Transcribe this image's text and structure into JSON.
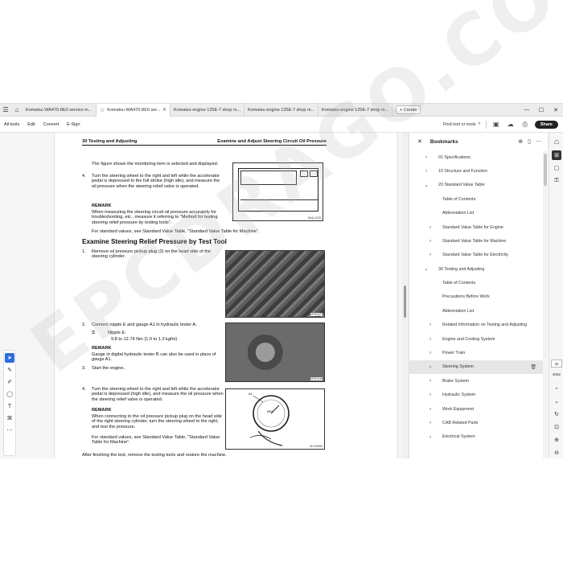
{
  "tabs": [
    {
      "label": "Komatsu WA470-8E0 service m...",
      "active": false,
      "starred": false
    },
    {
      "label": "Komatsu WA470-8E0 ser...",
      "active": true,
      "starred": true
    },
    {
      "label": "Komatsu engine 125E-7 shop m...",
      "active": false,
      "starred": false
    },
    {
      "label": "Komatsu engine 125E-7 shop m...",
      "active": false,
      "starred": false
    },
    {
      "label": "Komatsu engine 125E-7 shop m...",
      "active": false,
      "starred": false
    }
  ],
  "create_label": "Create",
  "menu": [
    "All tools",
    "Edit",
    "Convert",
    "E-Sign"
  ],
  "find_label": "Find text or tools",
  "share_label": "Share",
  "document": {
    "header_left": "30 Testing and Adjusting",
    "header_right": "Examine and Adjust Steering Circuit Oil Pressure",
    "para1": "The figure shows the monitoring item is selected and displayed.",
    "step4_num": "4.",
    "step4_text": "Turn the steering wheel to the right and left while the accelerator pedal is depressed to the full stroke (high idle), and measure the oil pressure when the steering relief valve is operated.",
    "remark_label": "REMARK",
    "remark1": "When measuring the steering circuit oil pressure accurately for troubleshooting, etc., measure it referring to \"Method for testing steering relief pressure by testing tools\".",
    "std1": "For standard values, see Standard Value Table, \"Standard Value Table for Machine\".",
    "heading": "Examine Steering Relief Pressure by Test Tool",
    "s1_num": "1.",
    "s1_text": "Remove oil pressure pickup plug (2) on the head side of the steering cylinder.",
    "s2_num": "2.",
    "s2_text": "Connect nipple E and gauge A1 in hydraulic tester A.",
    "nipple_label": "Nipple E:",
    "nipple_torque": "9.8 to 12.74 Nm {1.0 to 1.3 kgfm}",
    "remark2": "Gauge in digital hydraulic tester B can also be used in place of gauge A1.",
    "s3_num": "3.",
    "s3_text": "Start the engine.",
    "s4_num": "4.",
    "s4_text": "Turn the steering wheel to the right and left while the accelerator pedal is depressed (high idle), and measure the oil pressure when the steering relief valve is operated.",
    "remark3": "When connecting to the oil pressure pickup plug on the head side of the right steering cylinder, turn the steering wheel to the right, and test the pressure.",
    "std2": "For standard values, see Standard Value Table, \"Standard Value Table for Machine\".",
    "final": "After finishing the test, remove the testing tools and restore the machine.",
    "fig1_id": "9A4L1233",
    "fig2_id": "9F9I1021",
    "fig3_id": "9F9I1036",
    "fig4_id": "9H7I2E89",
    "gauge_label": "MPa",
    "fig4_callout": "A1"
  },
  "bookmarks": {
    "title": "Bookmarks",
    "items": [
      {
        "label": "01 Specifications",
        "level": 0,
        "chevron": "right"
      },
      {
        "label": "10 Structure and Function",
        "level": 0,
        "chevron": "right"
      },
      {
        "label": "20 Standard Value Table",
        "level": 0,
        "chevron": "down"
      },
      {
        "label": "Table of Contents",
        "level": 1,
        "chevron": ""
      },
      {
        "label": "Abbreviation List",
        "level": 1,
        "chevron": ""
      },
      {
        "label": "Standard Value Table for Engine",
        "level": 1,
        "chevron": "right"
      },
      {
        "label": "Standard Value Table for Machine",
        "level": 1,
        "chevron": "right"
      },
      {
        "label": "Standard Value Table for Electricity",
        "level": 1,
        "chevron": "right"
      },
      {
        "label": "30 Testing and Adjusting",
        "level": 0,
        "chevron": "down"
      },
      {
        "label": "Table of Contents",
        "level": 1,
        "chevron": ""
      },
      {
        "label": "Precautions Before Work",
        "level": 1,
        "chevron": ""
      },
      {
        "label": "Abbreviation List",
        "level": 1,
        "chevron": ""
      },
      {
        "label": "Related Information on Testing and Adjusting",
        "level": 1,
        "chevron": "right"
      },
      {
        "label": "Engine and Cooling System",
        "level": 1,
        "chevron": "right"
      },
      {
        "label": "Power Train",
        "level": 1,
        "chevron": "right"
      },
      {
        "label": "Steering System",
        "level": 1,
        "chevron": "right",
        "selected": true
      },
      {
        "label": "Brake System",
        "level": 1,
        "chevron": "right"
      },
      {
        "label": "Hydraulic System",
        "level": 1,
        "chevron": "right"
      },
      {
        "label": "Work Equipment",
        "level": 1,
        "chevron": "right"
      },
      {
        "label": "CAB Related Parts",
        "level": 1,
        "chevron": "right"
      },
      {
        "label": "Electrical System",
        "level": 1,
        "chevron": "right"
      }
    ]
  },
  "page_indicator": {
    "current": "30",
    "total": "4062"
  },
  "watermark": "EPCDRAGO.COM",
  "accent": "#2d6cdf"
}
